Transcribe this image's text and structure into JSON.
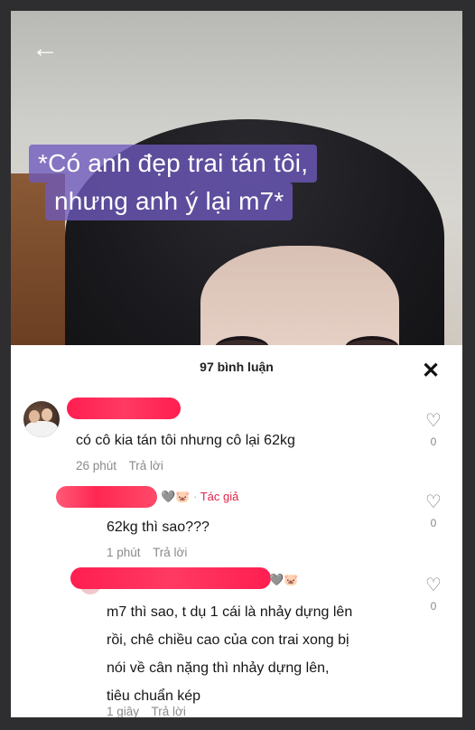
{
  "video": {
    "caption_line1": "*Có anh đẹp trai tán tôi,",
    "caption_line2": "nhưng anh ý lại m7*",
    "back_icon": "arrow-left-icon"
  },
  "comments_panel": {
    "title": "97 bình luận",
    "close_icon": "close-icon",
    "comments": [
      {
        "text": "có cô kia tán tôi nhưng cô lại 62kg",
        "time": "26 phút",
        "reply": "Trả lời",
        "likes": "0"
      },
      {
        "author_badge": "Tác giả",
        "separator": "·",
        "icons": "🩶🐷",
        "text": "62kg thì sao???",
        "time": "1 phút",
        "reply": "Trả lời",
        "likes": "0"
      },
      {
        "icons": "🩶🐷",
        "text_lines": [
          "m7 thì sao, t dụ 1 cái là nhảy dựng lên",
          "rồi, chê chiều cao của con trai xong bị",
          "nói về cân nặng thì nhảy dựng lên,",
          "tiêu chuẩn kép"
        ],
        "time": "1 giây",
        "reply": "Trả lời",
        "likes": "0"
      }
    ]
  },
  "colors": {
    "caption_bg": "#6e5abe",
    "redaction": "#ff2752",
    "author_badge": "#e0244a"
  }
}
